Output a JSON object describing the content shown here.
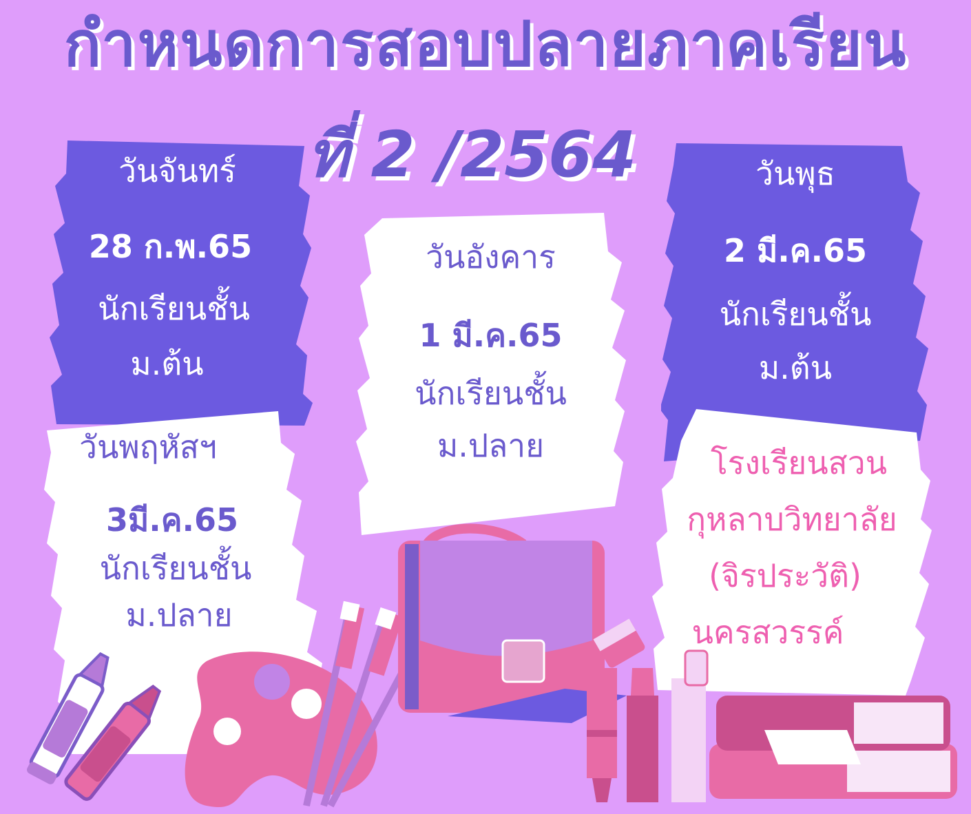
{
  "title": "กำหนดการสอบปลายภาคเรียน",
  "subtitle": "ที่ 2 /2564",
  "colors": {
    "background": "#df9dfb",
    "purple_panel": "#6c5ae0",
    "white_panel": "#ffffff",
    "text_purple": "#6a5acd",
    "text_pink": "#ee5fb0",
    "accent_pink": "#e86ba6"
  },
  "schedule": [
    {
      "day": "วันจันทร์",
      "date": "28 ก.พ.65",
      "group_line1": "นักเรียนชั้น",
      "group_line2": "ม.ต้น"
    },
    {
      "day": "วันอังคาร",
      "date": "1 มี.ค.65",
      "group_line1": "นักเรียนชั้น",
      "group_line2": "ม.ปลาย"
    },
    {
      "day": "วันพุธ",
      "date": "2 มี.ค.65",
      "group_line1": "นักเรียนชั้น",
      "group_line2": "ม.ต้น"
    },
    {
      "day": "วันพฤหัสฯ",
      "date": "3มี.ค.65",
      "group_line1": "นักเรียนชั้น",
      "group_line2": "ม.ปลาย"
    }
  ],
  "school": {
    "line1": "โรงเรียนสวน",
    "line2": "กุหลาบวิทยาลัย",
    "line3": "(จิรประวัติ)",
    "line4": "นครสวรรค์"
  },
  "decorations": [
    "crayon-icon",
    "paint-palette-icon",
    "paintbrush-icon",
    "briefcase-icon",
    "highlighter-icon",
    "pencil-sharpener-icon",
    "books-icon"
  ]
}
